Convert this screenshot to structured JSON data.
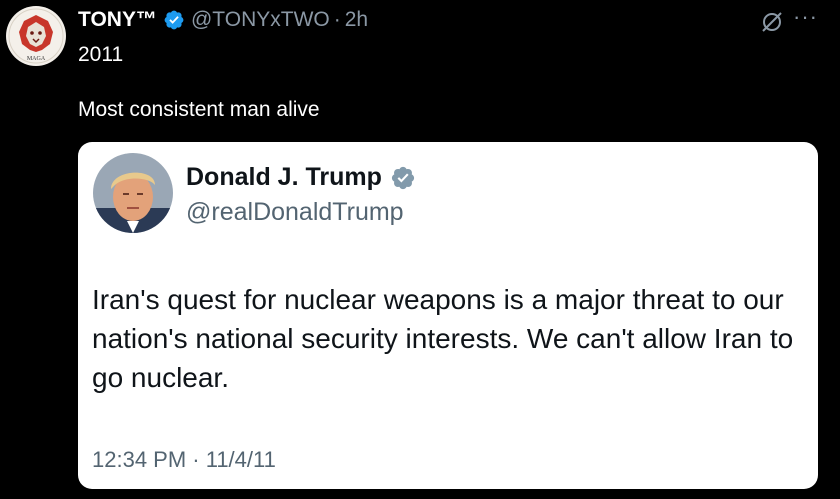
{
  "post": {
    "author_name": "TONY™",
    "handle": "@TONYxTWO",
    "separator": "·",
    "time": "2h",
    "year_text": "2011",
    "text": "Most consistent man alive",
    "avatar_text": "MAGA"
  },
  "quoted": {
    "author_name": "Donald J. Trump",
    "handle": "@realDonaldTrump",
    "text": "Iran's quest for nuclear weapons is a major threat to our nation's national security interests. We can't allow Iran to go nuclear.",
    "timestamp": "12:34 PM · 11/4/11"
  },
  "icons": {
    "verified": "verified-badge-icon",
    "grok": "grok-icon",
    "more": "more-options-icon"
  },
  "colors": {
    "background": "#000000",
    "verified_blue": "#1d9bf0",
    "verified_gray": "#829aab",
    "secondary_text": "#8b98a5",
    "card_background": "#ffffff",
    "card_text": "#0f1419"
  }
}
